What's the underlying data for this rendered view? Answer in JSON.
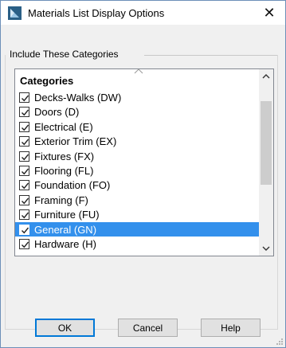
{
  "window": {
    "title": "Materials List Display Options",
    "close_label": "✕"
  },
  "group": {
    "label": "Include These Categories"
  },
  "list": {
    "header": "Categories",
    "items": [
      {
        "label": "Decks-Walks (DW)",
        "checked": true,
        "selected": false
      },
      {
        "label": "Doors (D)",
        "checked": true,
        "selected": false
      },
      {
        "label": "Electrical (E)",
        "checked": true,
        "selected": false
      },
      {
        "label": "Exterior Trim (EX)",
        "checked": true,
        "selected": false
      },
      {
        "label": "Fixtures (FX)",
        "checked": true,
        "selected": false
      },
      {
        "label": "Flooring (FL)",
        "checked": true,
        "selected": false
      },
      {
        "label": "Foundation (FO)",
        "checked": true,
        "selected": false
      },
      {
        "label": "Framing (F)",
        "checked": true,
        "selected": false
      },
      {
        "label": "Furniture (FU)",
        "checked": true,
        "selected": false
      },
      {
        "label": "General (GN)",
        "checked": true,
        "selected": true
      },
      {
        "label": "Hardware (H)",
        "checked": true,
        "selected": false
      }
    ]
  },
  "buttons": {
    "ok": "OK",
    "cancel": "Cancel",
    "help": "Help"
  },
  "colors": {
    "selection": "#3390ec",
    "default_button_border": "#0078d7"
  }
}
